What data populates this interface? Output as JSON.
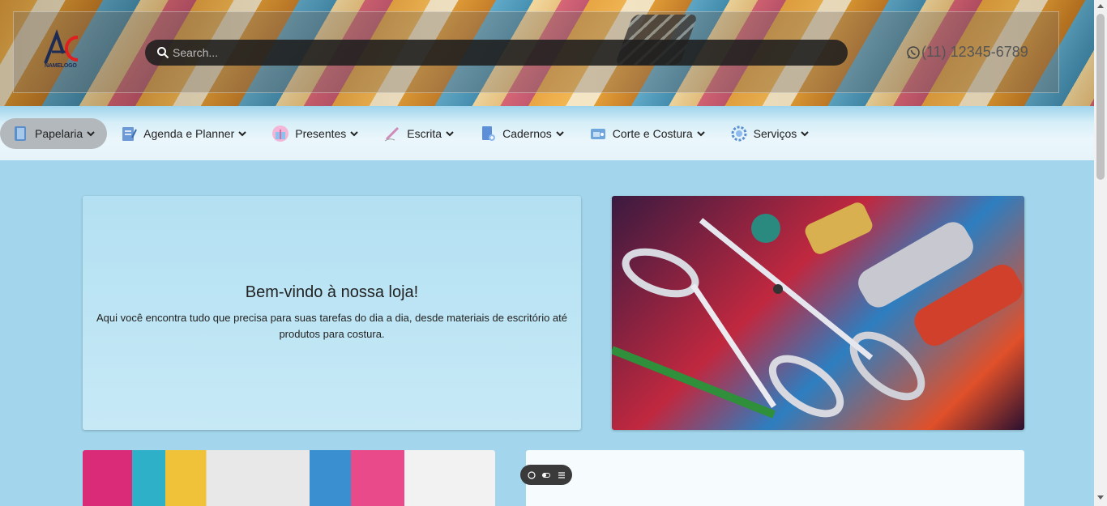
{
  "header": {
    "logo_text": "NAMELOGO",
    "search_placeholder": "Search...",
    "phone": "(11) 12345-6789"
  },
  "nav": {
    "items": [
      {
        "label": "Papelaria",
        "icon": "notebook-icon",
        "active": true
      },
      {
        "label": "Agenda e Planner",
        "icon": "planner-icon",
        "active": false
      },
      {
        "label": "Presentes",
        "icon": "gift-icon",
        "active": false
      },
      {
        "label": "Escrita",
        "icon": "pen-icon",
        "active": false
      },
      {
        "label": "Cadernos",
        "icon": "notebook-add-icon",
        "active": false
      },
      {
        "label": "Corte e Costura",
        "icon": "sewing-machine-icon",
        "active": false
      },
      {
        "label": "Serviços",
        "icon": "services-gear-icon",
        "active": false
      }
    ]
  },
  "welcome": {
    "title": "Bem-vindo à nossa loja!",
    "text": "Aqui você encontra tudo que precisa para suas tarefas do dia a dia, desde materiais de escritório até produtos para costura."
  },
  "images": {
    "scissors": "scissors-and-staplers-image",
    "shelf": "stationery-shelf-image"
  },
  "toolbar": {
    "icons": [
      "chat-icon",
      "toggle-icon",
      "settings-icon"
    ]
  },
  "colors": {
    "page_bg": "#a3d6ec",
    "active_nav": "#b3b8bc",
    "card_bg": "#b3e0f2"
  }
}
